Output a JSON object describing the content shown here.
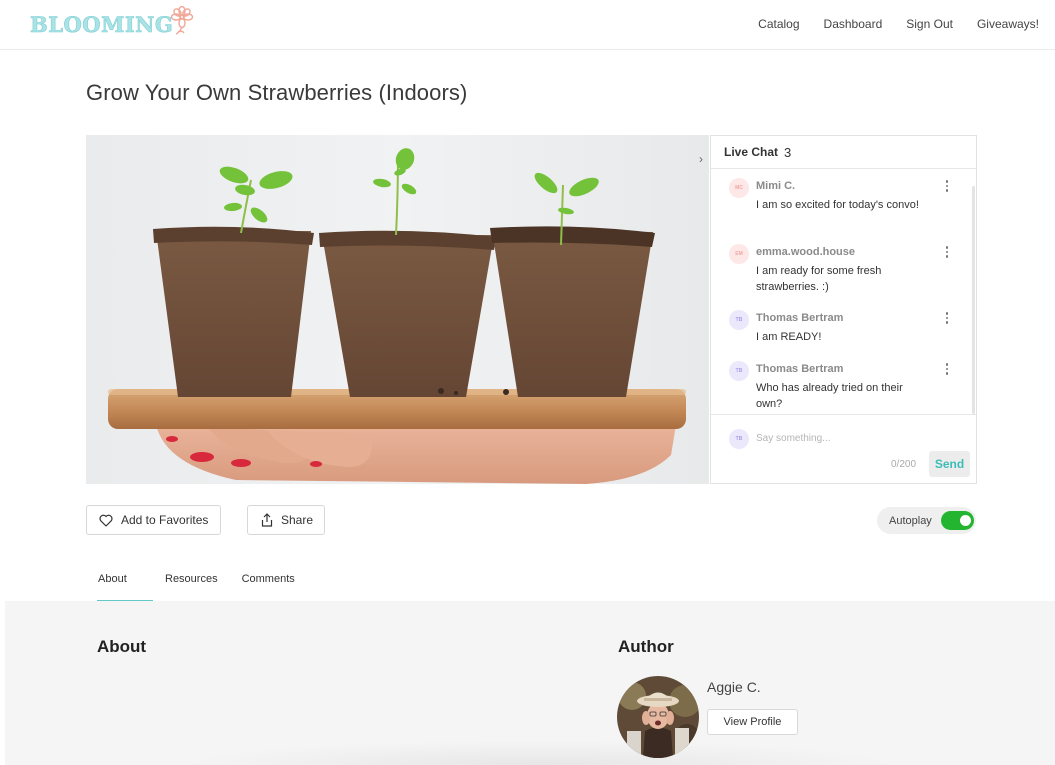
{
  "header": {
    "logo_text": "BLOOMING",
    "nav": [
      {
        "label": "Catalog"
      },
      {
        "label": "Dashboard"
      },
      {
        "label": "Sign Out"
      },
      {
        "label": "Giveaways!"
      }
    ]
  },
  "page": {
    "title": "Grow Your Own Strawberries (Indoors)"
  },
  "media": {
    "description": "Three seedlings in peat pots on a wooden board held by a hand"
  },
  "chat": {
    "title": "Live Chat",
    "count": "3",
    "collapse_icon": "chevron-right",
    "messages": [
      {
        "initials": "MC",
        "author": "Mimi C.",
        "text": "I am so excited for today's convo!",
        "avatar_color": "pink"
      },
      {
        "initials": "EM",
        "author": "emma.wood.house",
        "text": "I am ready for some fresh strawberries. :)",
        "avatar_color": "pink"
      },
      {
        "initials": "TB",
        "author": "Thomas Bertram",
        "text": "I am READY!",
        "avatar_color": "purple"
      },
      {
        "initials": "TB",
        "author": "Thomas Bertram",
        "text": "Who has already tried on their own?",
        "avatar_color": "purple"
      }
    ],
    "input": {
      "user_initials": "TB",
      "placeholder": "Say something...",
      "value": "",
      "char_count": "0/200",
      "send_label": "Send"
    }
  },
  "actions": {
    "favorite_label": "Add to Favorites",
    "share_label": "Share",
    "autoplay_label": "Autoplay",
    "autoplay_on": true
  },
  "tabs": [
    {
      "label": "About",
      "active": true
    },
    {
      "label": "Resources",
      "active": false
    },
    {
      "label": "Comments",
      "active": false
    }
  ],
  "about": {
    "heading": "About"
  },
  "author": {
    "heading": "Author",
    "name": "Aggie C.",
    "view_profile_label": "View Profile"
  },
  "colors": {
    "brand_teal": "#66c9c9",
    "send_text": "#3dbdb7",
    "toggle_on": "#23b52f",
    "logo_flower": "#f0a898"
  }
}
